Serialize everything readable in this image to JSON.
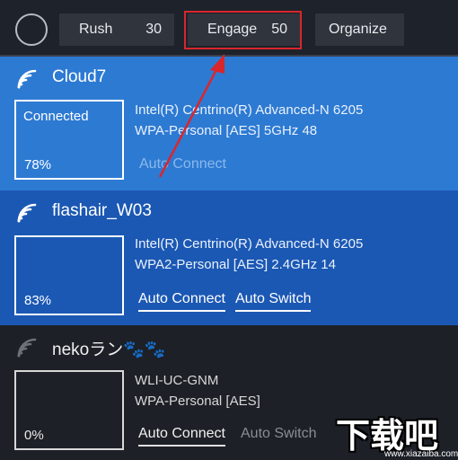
{
  "toolbar": {
    "rush": {
      "label": "Rush",
      "value": "30"
    },
    "engage": {
      "label": "Engage",
      "value": "50"
    },
    "organize": {
      "label": "Organize"
    }
  },
  "networks": [
    {
      "name": "Cloud7",
      "status": "Connected",
      "signal": "78%",
      "adapter": "Intel(R) Centrino(R) Advanced-N 6205",
      "security": "WPA-Personal [AES] 5GHz 48",
      "auto_connect": "Auto Connect"
    },
    {
      "name": "flashair_W03",
      "status": "",
      "signal": "83%",
      "adapter": "Intel(R) Centrino(R) Advanced-N 6205",
      "security": "WPA2-Personal [AES] 2.4GHz 14",
      "auto_connect": "Auto Connect",
      "auto_switch": "Auto Switch"
    },
    {
      "name": "nekoラン🐾🐾",
      "status": "",
      "signal": "0%",
      "adapter": "WLI-UC-GNM",
      "security": "WPA-Personal [AES]",
      "auto_connect": "Auto Connect",
      "auto_switch": "Auto Switch"
    }
  ],
  "colors": {
    "selected": "#2d7ad3",
    "secondary": "#1b58b4",
    "dark": "#1d2027",
    "highlight": "#d9262d"
  },
  "watermark": {
    "text": "下载吧",
    "url": "www.xiazaiba.com"
  }
}
